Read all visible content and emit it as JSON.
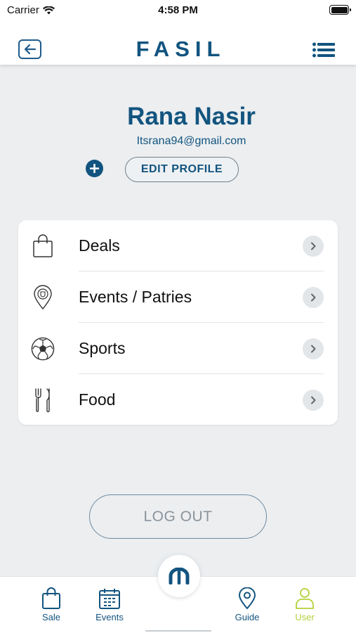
{
  "status_bar": {
    "carrier": "Carrier",
    "time": "4:58 PM",
    "icons": [
      "wifi-icon",
      "battery-icon"
    ]
  },
  "header": {
    "logo_text": "FASIL",
    "back_icon": "arrow-left-icon",
    "menu_icon": "list-icon"
  },
  "profile": {
    "name": "Rana Nasir",
    "email": "Itsrana94@gmail.com",
    "add_icon": "plus-icon",
    "edit_label": "EDIT PROFILE"
  },
  "menu": {
    "items": [
      {
        "label": "Deals",
        "icon": "shopping-bag-icon"
      },
      {
        "label": "Events / Patries",
        "icon": "location-badge-icon"
      },
      {
        "label": "Sports",
        "icon": "soccer-ball-icon"
      },
      {
        "label": "Food",
        "icon": "fork-knife-icon"
      }
    ]
  },
  "logout_label": "LOG OUT",
  "tab_bar": {
    "tabs": [
      {
        "label": "Sale",
        "icon": "shopping-bag-icon",
        "active": false
      },
      {
        "label": "Events",
        "icon": "calendar-icon",
        "active": false
      },
      {
        "label": "Guide",
        "icon": "map-pin-icon",
        "active": false
      },
      {
        "label": "User",
        "icon": "user-icon",
        "active": true
      }
    ],
    "center_icon": "fasil-logo-icon"
  },
  "colors": {
    "brand": "#12547f",
    "active_tab": "#b3d13a",
    "background": "#eceef0"
  }
}
